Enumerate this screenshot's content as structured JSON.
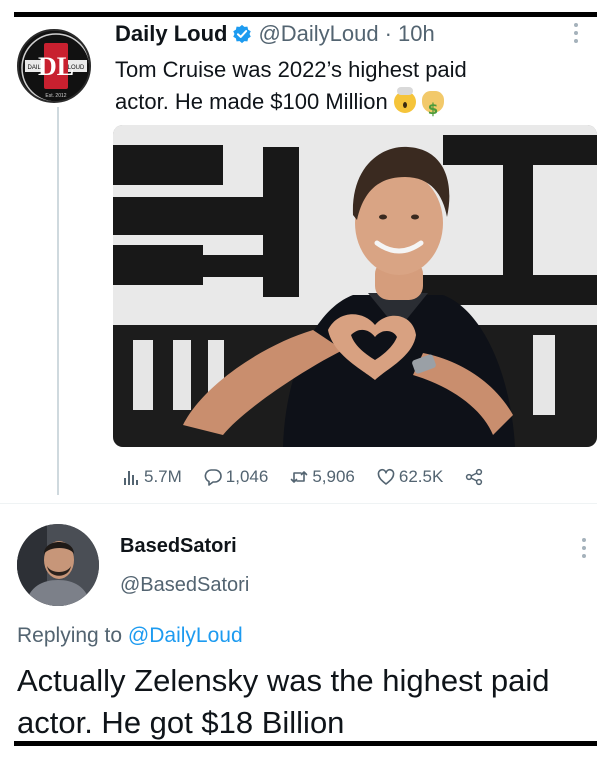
{
  "tweet": {
    "author_name": "Daily Loud",
    "handle": "@DailyLoud",
    "separator": "·",
    "time": "10h",
    "text_line1": "Tom Cruise was 2022’s highest paid",
    "text_line2": "actor. He made $100 Million",
    "avatar_logo": {
      "left": "DAILY",
      "right": "LOUD",
      "bottom": "Est. 2012",
      "monogram": "DL"
    },
    "media_icon": "photo-tom-cruise-heart-hands",
    "stats": {
      "views": "5.7M",
      "replies": "1,046",
      "retweets": "5,906",
      "likes": "62.5K"
    }
  },
  "reply": {
    "author_name": "BasedSatori",
    "handle": "@BasedSatori",
    "replying_prefix": "Replying to",
    "replying_mention": "@DailyLoud",
    "text": "Actually Zelensky was the highest paid actor. He got $18 Billion"
  },
  "icons": {
    "verified": "verified-badge-icon",
    "views": "views-bar-icon",
    "reply": "reply-bubble-icon",
    "retweet": "retweet-icon",
    "like": "heart-icon",
    "share": "share-icon"
  },
  "colors": {
    "text": "#0f1419",
    "secondary": "#536471",
    "accent": "#1d9bf0",
    "logo_red": "#c8202f"
  }
}
